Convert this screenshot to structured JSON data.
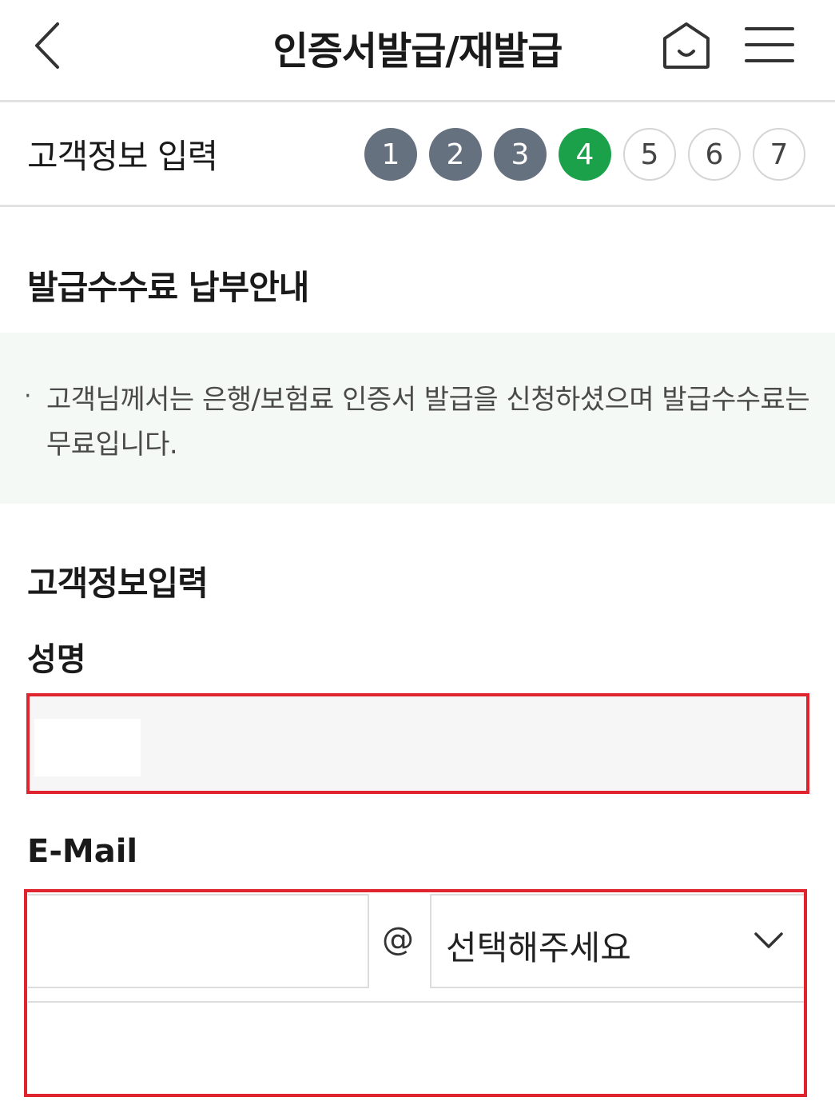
{
  "header": {
    "title": "인증서발급/재발급",
    "back_icon": "chevron-left-icon",
    "home_icon": "home-icon",
    "menu_icon": "hamburger-menu-icon"
  },
  "progress": {
    "title": "고객정보 입력",
    "current_step": 4,
    "steps": [
      "1",
      "2",
      "3",
      "4",
      "5",
      "6",
      "7"
    ]
  },
  "fee_notice": {
    "heading": "발급수수료 납부안내",
    "bullet": "·",
    "text": "고객님께서는 은행/보험료 인증서 발급을 신청하셨으며 발급수수료는 무료입니다."
  },
  "customer_info": {
    "heading": "고객정보입력",
    "name_label": "성명",
    "name_value": "",
    "email_label": "E-Mail",
    "email_id_value": "",
    "at_sign": "@",
    "domain_select_value": "선택해주세요",
    "email_direct_value": ""
  },
  "colors": {
    "step_done": "#66717f",
    "step_current": "#1aa14a",
    "highlight_border": "#e0242f",
    "notice_bg": "#f5f9f6"
  }
}
